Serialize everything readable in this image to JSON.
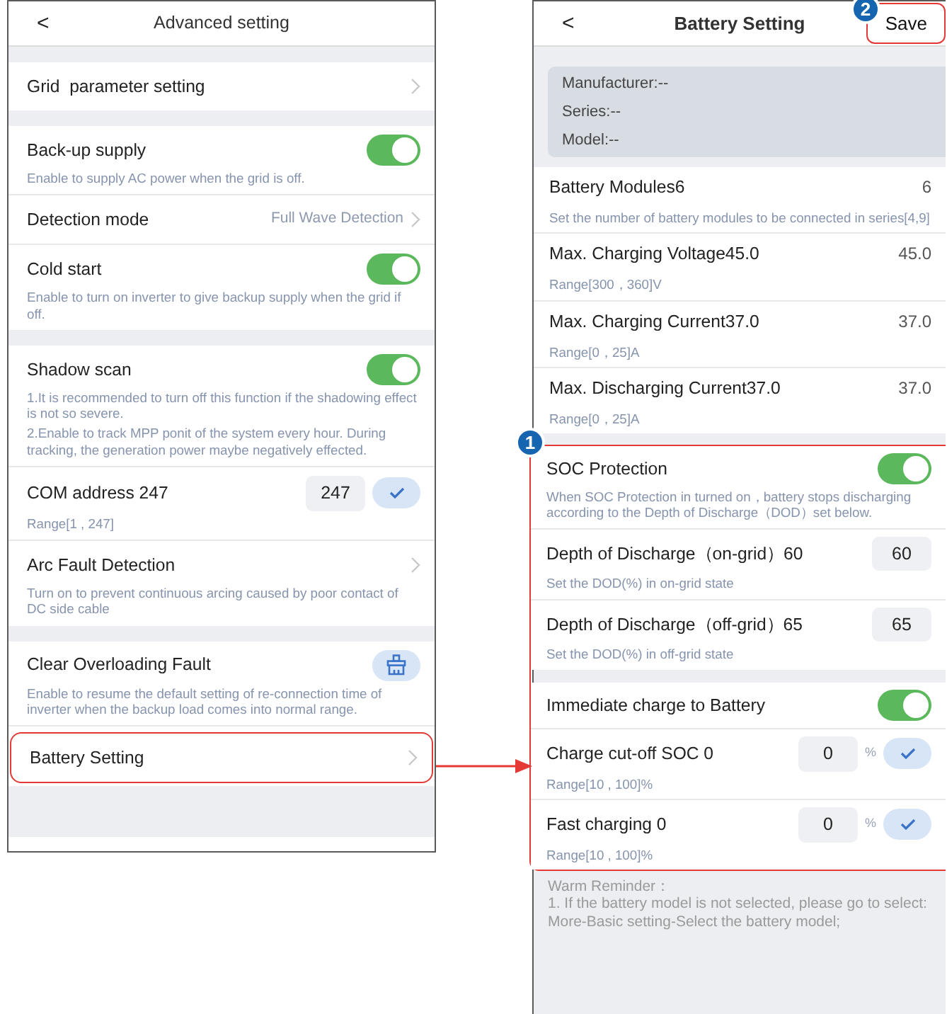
{
  "left_screen": {
    "back": "<",
    "title": "Advanced setting",
    "sections": [
      {
        "items": [
          {
            "kind": "link",
            "label": "Grid  parameter setting",
            "highlighted": false
          }
        ]
      },
      {
        "items": [
          {
            "kind": "toggle",
            "label": "Back-up supply",
            "on": true,
            "hints": [
              "Enable to supply AC power when the grid is off."
            ]
          },
          {
            "kind": "link",
            "label": "Detection mode",
            "value": "Full Wave Detection",
            "highlighted": false
          },
          {
            "kind": "toggle",
            "label": "Cold start",
            "on": true,
            "hints": [
              "Enable to turn on inverter to give backup supply when the grid if off."
            ]
          }
        ]
      },
      {
        "items": [
          {
            "kind": "toggle",
            "label": "Shadow scan",
            "on": true,
            "hints": [
              "1.It is recommended to turn off this function if the shadowing effect is not so severe.",
              "2.Enable to track MPP ponit of the system every hour. During tracking, the generation power maybe negatively effected."
            ]
          },
          {
            "kind": "input",
            "label": "COM address 247",
            "value": "247",
            "hints": [
              "Range[1 , 247]"
            ]
          },
          {
            "kind": "link",
            "label": "Arc Fault Detection",
            "highlighted": false,
            "hints": [
              "Turn on to prevent continuous arcing caused by poor contact of DC side cable"
            ]
          }
        ]
      },
      {
        "items": [
          {
            "kind": "button",
            "label": "Clear Overloading Fault",
            "hints": [
              "Enable to resume the default setting of re-connection time of inverter when the backup load comes into normal range."
            ]
          },
          {
            "kind": "link",
            "label": "Battery Setting",
            "highlighted": true
          }
        ]
      }
    ]
  },
  "right_screen": {
    "back": "<",
    "title": "Battery Setting",
    "save": {
      "label": "Save",
      "highlighted": true,
      "badge": "2"
    },
    "info": [
      "Manufacturer:--",
      "Series:--",
      "Model:--"
    ],
    "blocks": [
      {
        "highlighted": false,
        "sections": [
          {
            "items": [
              {
                "kind": "value",
                "label": "Battery Modules6",
                "value": "6",
                "hints": [
                  "Set the number of battery modules to be connected in series[4,9]"
                ]
              },
              {
                "kind": "value",
                "label": "Max. Charging Voltage45.0",
                "value": "45.0",
                "hints": [
                  "Range[300，360]V"
                ]
              },
              {
                "kind": "value",
                "label": "Max. Charging Current37.0",
                "value": "37.0",
                "hints": [
                  "Range[0，25]A"
                ]
              },
              {
                "kind": "value",
                "label": "Max. Discharging Current37.0",
                "value": "37.0",
                "hints": [
                  "Range[0，25]A"
                ]
              }
            ]
          }
        ]
      },
      {
        "highlighted": true,
        "badge": "1",
        "sections": [
          {
            "items": [
              {
                "kind": "toggle",
                "label": "SOC Protection",
                "on": true,
                "hints": [
                  "When SOC Protection in turned on，battery stops discharging according to the Depth of Discharge（DOD）set below."
                ]
              },
              {
                "kind": "box",
                "label": "Depth of Discharge（on-grid）60",
                "value": "60",
                "hints": [
                  "Set the DOD(%) in on-grid state"
                ]
              },
              {
                "kind": "box",
                "label": "Depth of Discharge（off-grid）65",
                "value": "65",
                "hints": [
                  "Set the DOD(%) in off-grid state"
                ]
              }
            ]
          },
          {
            "items": [
              {
                "kind": "toggle",
                "label": "Immediate charge to Battery",
                "on": true
              },
              {
                "kind": "input",
                "label": "Charge cut-off SOC 0",
                "value": "0",
                "unit": "%",
                "hints": [
                  "Range[10 , 100]%"
                ]
              },
              {
                "kind": "input",
                "label": "Fast charging 0",
                "value": "0",
                "unit": "%",
                "hints": [
                  "Range[10 , 100]%"
                ]
              }
            ]
          }
        ]
      }
    ],
    "reminder": {
      "title": "Warm Reminder：",
      "lines": [
        "1. If the battery model is not selected, please go to select: More-Basic setting-Select the battery model;"
      ]
    }
  }
}
